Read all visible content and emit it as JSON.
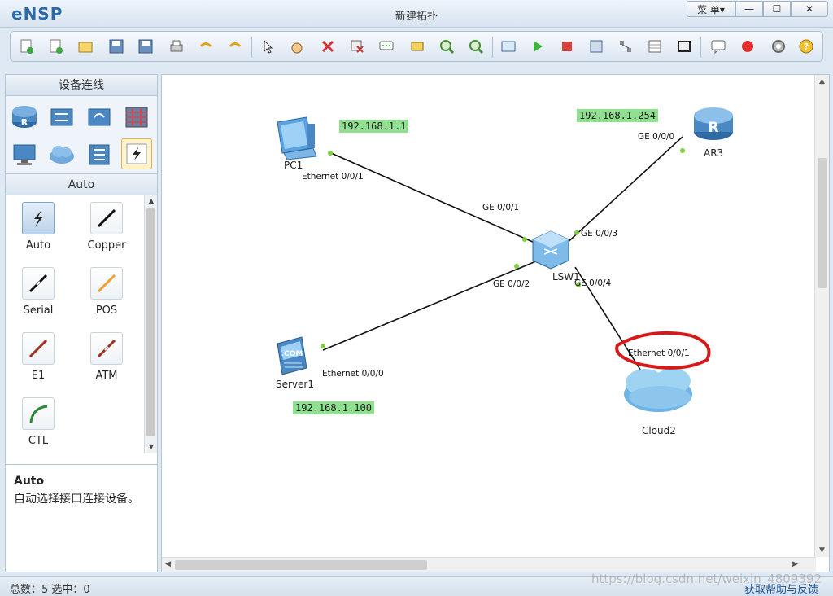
{
  "window": {
    "app_name": "eNSP",
    "title": "新建拓扑",
    "menu_label": "菜 单▾",
    "minimize": "—",
    "maximize": "☐",
    "close": "✕"
  },
  "left_panel": {
    "header": "设备连线",
    "cable_header": "Auto",
    "cables": [
      {
        "label": "Auto"
      },
      {
        "label": "Copper"
      },
      {
        "label": "Serial"
      },
      {
        "label": "POS"
      },
      {
        "label": "E1"
      },
      {
        "label": "ATM"
      },
      {
        "label": "CTL"
      }
    ],
    "description_title": "Auto",
    "description_text": "自动选择接口连接设备。"
  },
  "topology": {
    "nodes": {
      "pc1": "PC1",
      "ar3": "AR3",
      "lsw1": "LSW1",
      "server1": "Server1",
      "cloud2": "Cloud2"
    },
    "ports": {
      "pc1_eth": "Ethernet 0/0/1",
      "lsw_ge1": "GE 0/0/1",
      "ar3_ge0": "GE 0/0/0",
      "lsw_ge3": "GE 0/0/3",
      "lsw_ge2": "GE 0/0/2",
      "lsw_ge4": "GE 0/0/4",
      "cloud_eth": "Ethernet 0/0/1",
      "server_eth": "Ethernet 0/0/0"
    },
    "ip_labels": {
      "pc1": "192.168.1.1",
      "ar3": "192.168.1.254",
      "server1": "192.168.1.100"
    }
  },
  "status": {
    "left": "总数：5  选中：0",
    "right": "获取帮助与反馈"
  },
  "watermark": "https://blog.csdn.net/weixin_4809392"
}
